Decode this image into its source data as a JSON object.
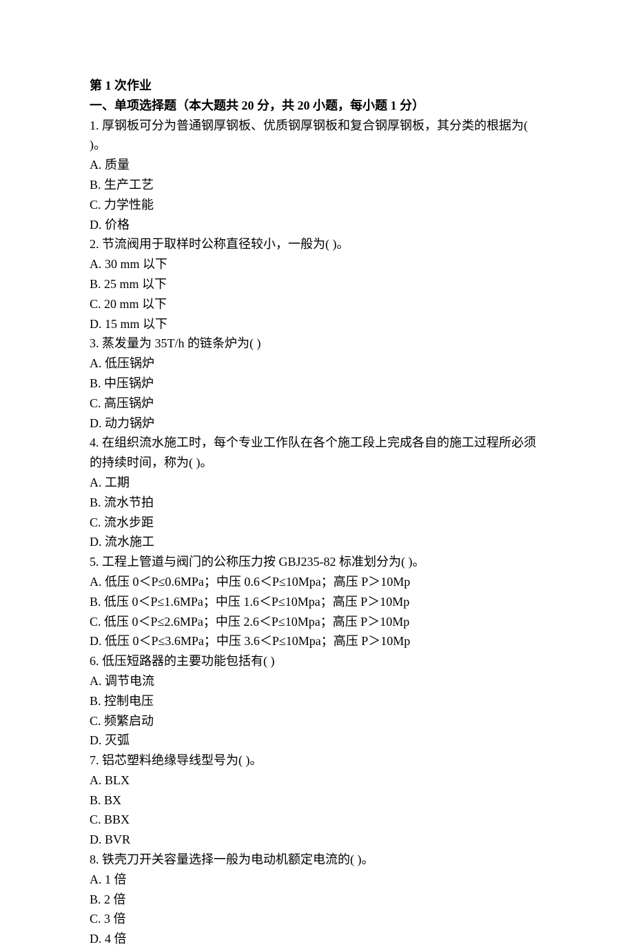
{
  "title": "第 1 次作业",
  "sectionHeader": "一、单项选择题（本大题共 20 分，共 20 小题，每小题 1 分）",
  "questions": [
    {
      "stem": "1. 厚钢板可分为普通钢厚钢板、优质钢厚钢板和复合钢厚钢板，其分类的根据为( )。",
      "options": [
        "A. 质量",
        "B. 生产工艺",
        "C. 力学性能",
        "D. 价格"
      ]
    },
    {
      "stem": "2. 节流阀用于取样时公称直径较小，一般为( )。",
      "options": [
        "A. 30 mm 以下",
        "B. 25 mm 以下",
        "C. 20 mm 以下",
        "D. 15 mm 以下"
      ]
    },
    {
      "stem": "3. 蒸发量为 35T/h 的链条炉为( )",
      "options": [
        "A. 低压锅炉",
        "B. 中压锅炉",
        "C. 高压锅炉",
        "D. 动力锅炉"
      ]
    },
    {
      "stem": "4. 在组织流水施工时，每个专业工作队在各个施工段上完成各自的施工过程所必须的持续时间，称为( )。",
      "options": [
        "A. 工期",
        "B. 流水节拍",
        "C. 流水步距",
        "D. 流水施工"
      ]
    },
    {
      "stem": "5. 工程上管道与阀门的公称压力按 GBJ235-82 标准划分为( )。",
      "options": [
        "A. 低压 0＜P≤0.6MPa；中压 0.6＜P≤10Mpa；高压 P＞10Mp",
        "B. 低压 0＜P≤1.6MPa；中压 1.6＜P≤10Mpa；高压 P＞10Mp",
        "C. 低压 0＜P≤2.6MPa；中压 2.6＜P≤10Mpa；高压 P＞10Mp",
        "D. 低压 0＜P≤3.6MPa；中压 3.6＜P≤10Mpa；高压 P＞10Mp"
      ]
    },
    {
      "stem": "6. 低压短路器的主要功能包括有( )",
      "options": [
        "A. 调节电流",
        "B. 控制电压",
        "C. 频繁启动",
        "D. 灭弧"
      ]
    },
    {
      "stem": "7. 铝芯塑料绝缘导线型号为( )。",
      "options": [
        "A. BLX",
        "B. BX",
        "C. BBX",
        "D. BVR"
      ]
    },
    {
      "stem": "8. 铁壳刀开关容量选择一般为电动机额定电流的( )。",
      "options": [
        "A. 1 倍",
        "B. 2 倍",
        "C. 3 倍",
        "D. 4 倍"
      ]
    }
  ]
}
